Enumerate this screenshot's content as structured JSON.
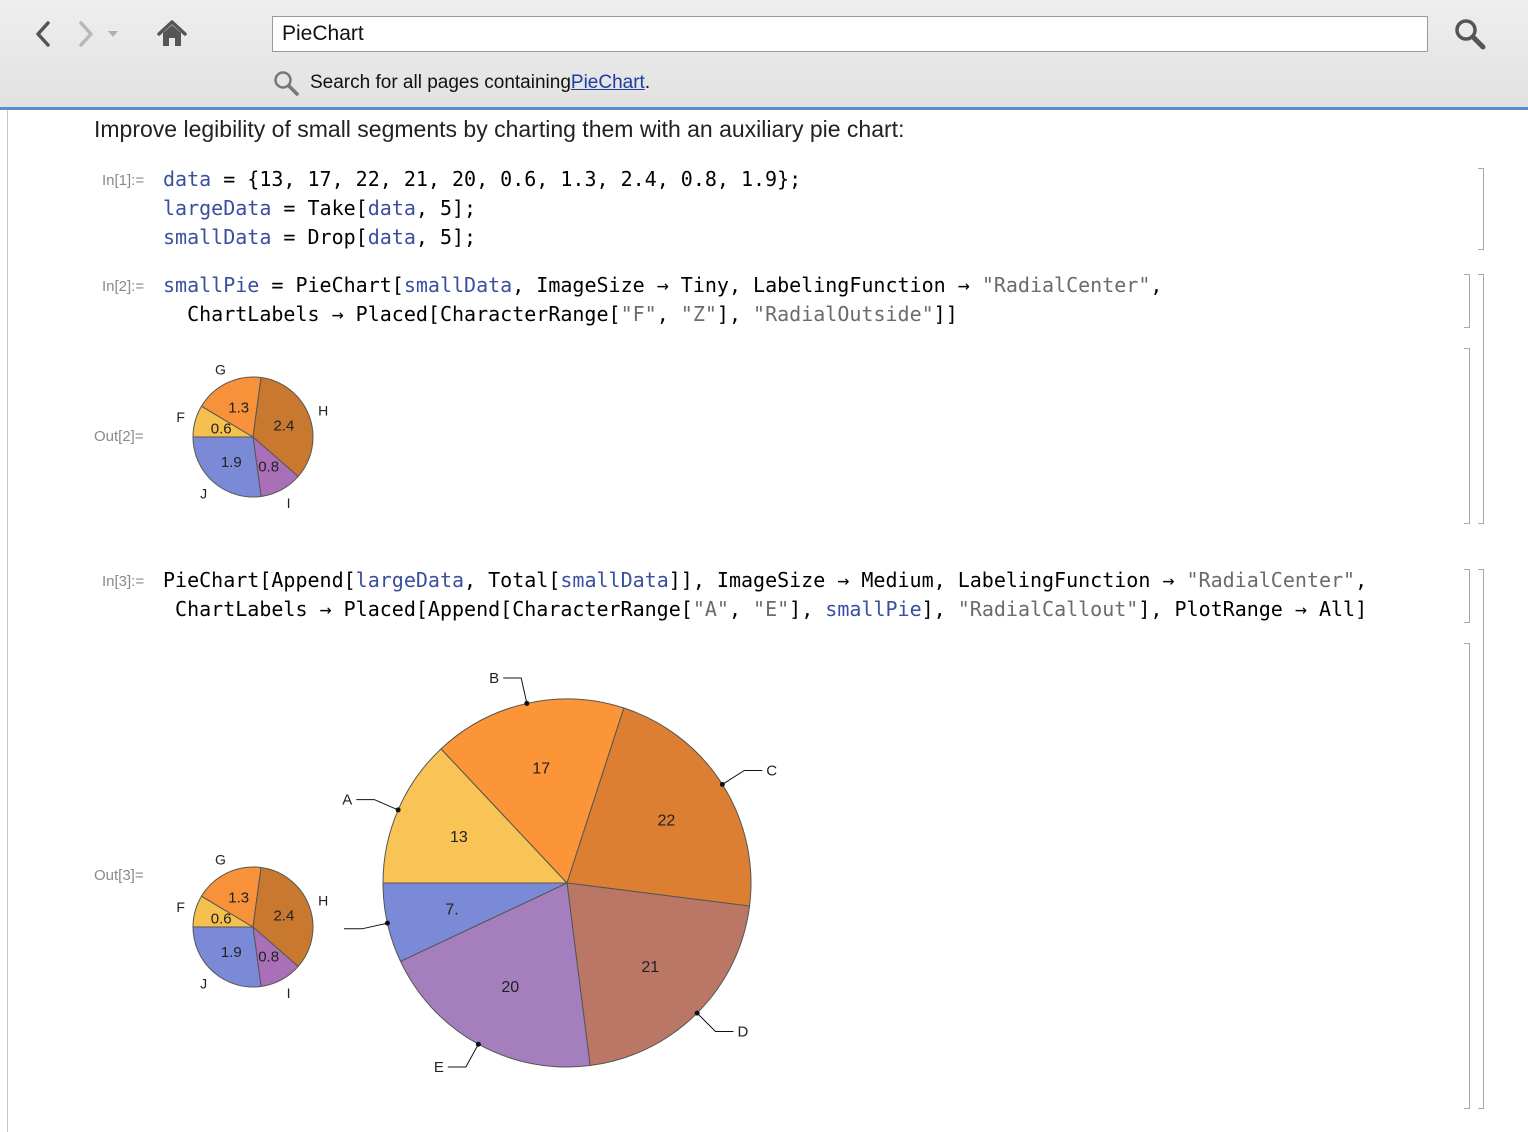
{
  "toolbar": {
    "search_value": "PieChart",
    "search_all_prefix": "Search for all pages containing ",
    "search_all_link": "PieChart",
    "search_all_suffix": "."
  },
  "notebook": {
    "intro": "Improve legibility of small segments by charting them with an auxiliary pie chart:",
    "in1_label": "In[1]:=",
    "in2_label": "In[2]:=",
    "out2_label": "Out[2]=",
    "in3_label": "In[3]:=",
    "out3_label": "Out[3]="
  },
  "chart_data": [
    {
      "type": "pie",
      "name": "smallPie",
      "categories": [
        "F",
        "G",
        "H",
        "I",
        "J"
      ],
      "values": [
        0.6,
        1.3,
        2.4,
        0.8,
        1.9
      ],
      "value_labels": [
        "0.6",
        "1.3",
        "2.4",
        "0.8",
        "1.9"
      ],
      "colors": [
        "#f5c04e",
        "#f7923a",
        "#c8782f",
        "#a970b8",
        "#7b8ad6"
      ],
      "label_placement": "radial-outside"
    },
    {
      "type": "pie",
      "categories": [
        "A",
        "B",
        "C",
        "D",
        "E",
        "smallPie"
      ],
      "values": [
        13,
        17,
        22,
        21,
        20,
        7
      ],
      "value_labels": [
        "13",
        "17",
        "22",
        "21",
        "20",
        "7."
      ],
      "colors": [
        "#f9c456",
        "#fb9537",
        "#dd7f32",
        "#bb7766",
        "#a57fbd",
        "#7b8ad6"
      ],
      "label_placement": "radial-callout",
      "auxiliary_chart": "smallPie"
    }
  ]
}
